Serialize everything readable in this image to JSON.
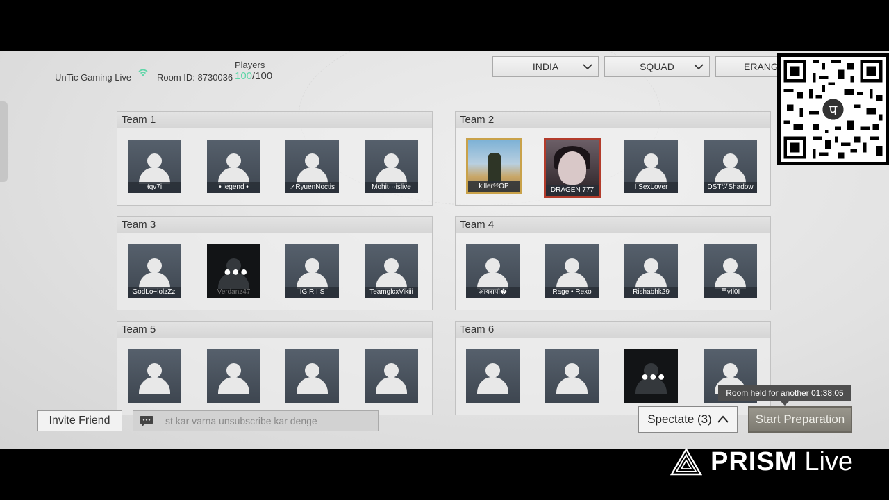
{
  "header": {
    "channel": "UnTic Gaming Live",
    "room_id": "Room ID: 8730036",
    "players_label": "Players",
    "players_current": "100",
    "players_max": "/100"
  },
  "filters": {
    "region": "INDIA",
    "mode": "SQUAD",
    "map": "ERANGEL"
  },
  "teams": [
    {
      "name": "Team 1",
      "players": [
        "ŧqv7i",
        "• legend •",
        "↗RyuenNoctis",
        "Mohit⋯islive"
      ]
    },
    {
      "name": "Team 2",
      "players": [
        "killer⁶⁶OP",
        "DRAGEN 777",
        "I SexLover",
        "DSTツShadow"
      ]
    },
    {
      "name": "Team 3",
      "players": [
        "GodLᴏ~lolzZzi",
        "Verdanz47",
        "ÌG R I S",
        "TeamglcxVikiii"
      ]
    },
    {
      "name": "Team 4",
      "players": [
        "आयरापी�",
        "Rage • Rexo",
        "Rishabhk29",
        "ᄐvIl0I"
      ]
    },
    {
      "name": "Team 5",
      "players": [
        "",
        "",
        "",
        ""
      ]
    },
    {
      "name": "Team 6",
      "players": [
        "",
        "",
        "",
        ""
      ]
    }
  ],
  "footer": {
    "invite_label": "Invite Friend",
    "chat_text": "st kar varna unsubscribe kar denge",
    "room_held": "Room held for another 01:38:05",
    "spectate_label": "Spectate (3)",
    "start_label": "Start Preparation"
  },
  "overlay": {
    "brand": "PRISM",
    "brand_suffix": "Live",
    "qr_icon": "phonepe-logo-icon"
  },
  "colors": {
    "player_count": "#5fd6a8",
    "start_button": "#8b887f",
    "tooltip": "#4e4e4e"
  }
}
